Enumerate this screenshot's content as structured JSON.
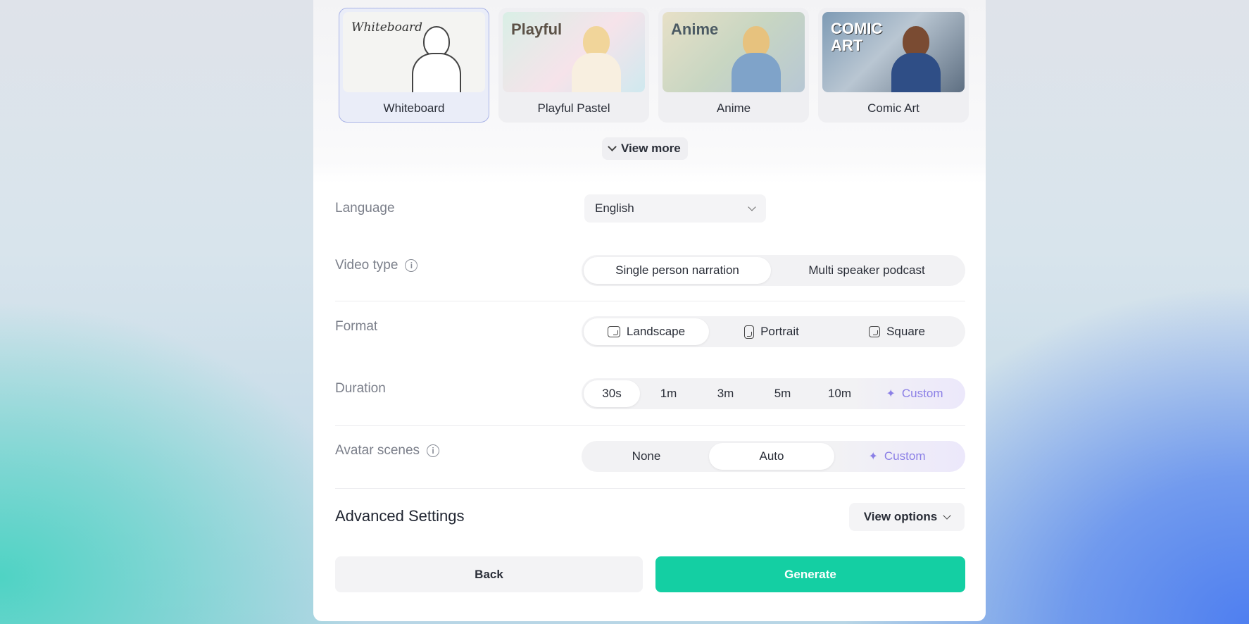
{
  "styles": [
    {
      "label": "Whiteboard",
      "thumb_text": "Whiteboard",
      "selected": true
    },
    {
      "label": "Playful Pastel",
      "thumb_text": "Playful",
      "selected": false
    },
    {
      "label": "Anime",
      "thumb_text": "Anime",
      "selected": false
    },
    {
      "label": "Comic Art",
      "thumb_text": "COMIC ART",
      "selected": false
    }
  ],
  "view_more_label": "View more",
  "language": {
    "label": "Language",
    "value": "English"
  },
  "video_type": {
    "label": "Video type",
    "options": [
      "Single person narration",
      "Multi speaker podcast"
    ],
    "selected": "Single person narration"
  },
  "format": {
    "label": "Format",
    "options": [
      "Landscape",
      "Portrait",
      "Square"
    ],
    "selected": "Landscape"
  },
  "duration": {
    "label": "Duration",
    "options": [
      "30s",
      "1m",
      "3m",
      "5m",
      "10m"
    ],
    "custom_label": "Custom",
    "selected": "30s"
  },
  "avatar_scenes": {
    "label": "Avatar scenes",
    "options": [
      "None",
      "Auto"
    ],
    "custom_label": "Custom",
    "selected": "Auto"
  },
  "advanced": {
    "title": "Advanced Settings",
    "view_options_label": "View options"
  },
  "buttons": {
    "back": "Back",
    "generate": "Generate"
  },
  "colors": {
    "accent_green": "#14cfa3",
    "custom_purple": "#8b7fe6",
    "selected_border": "#a9b3e6"
  }
}
